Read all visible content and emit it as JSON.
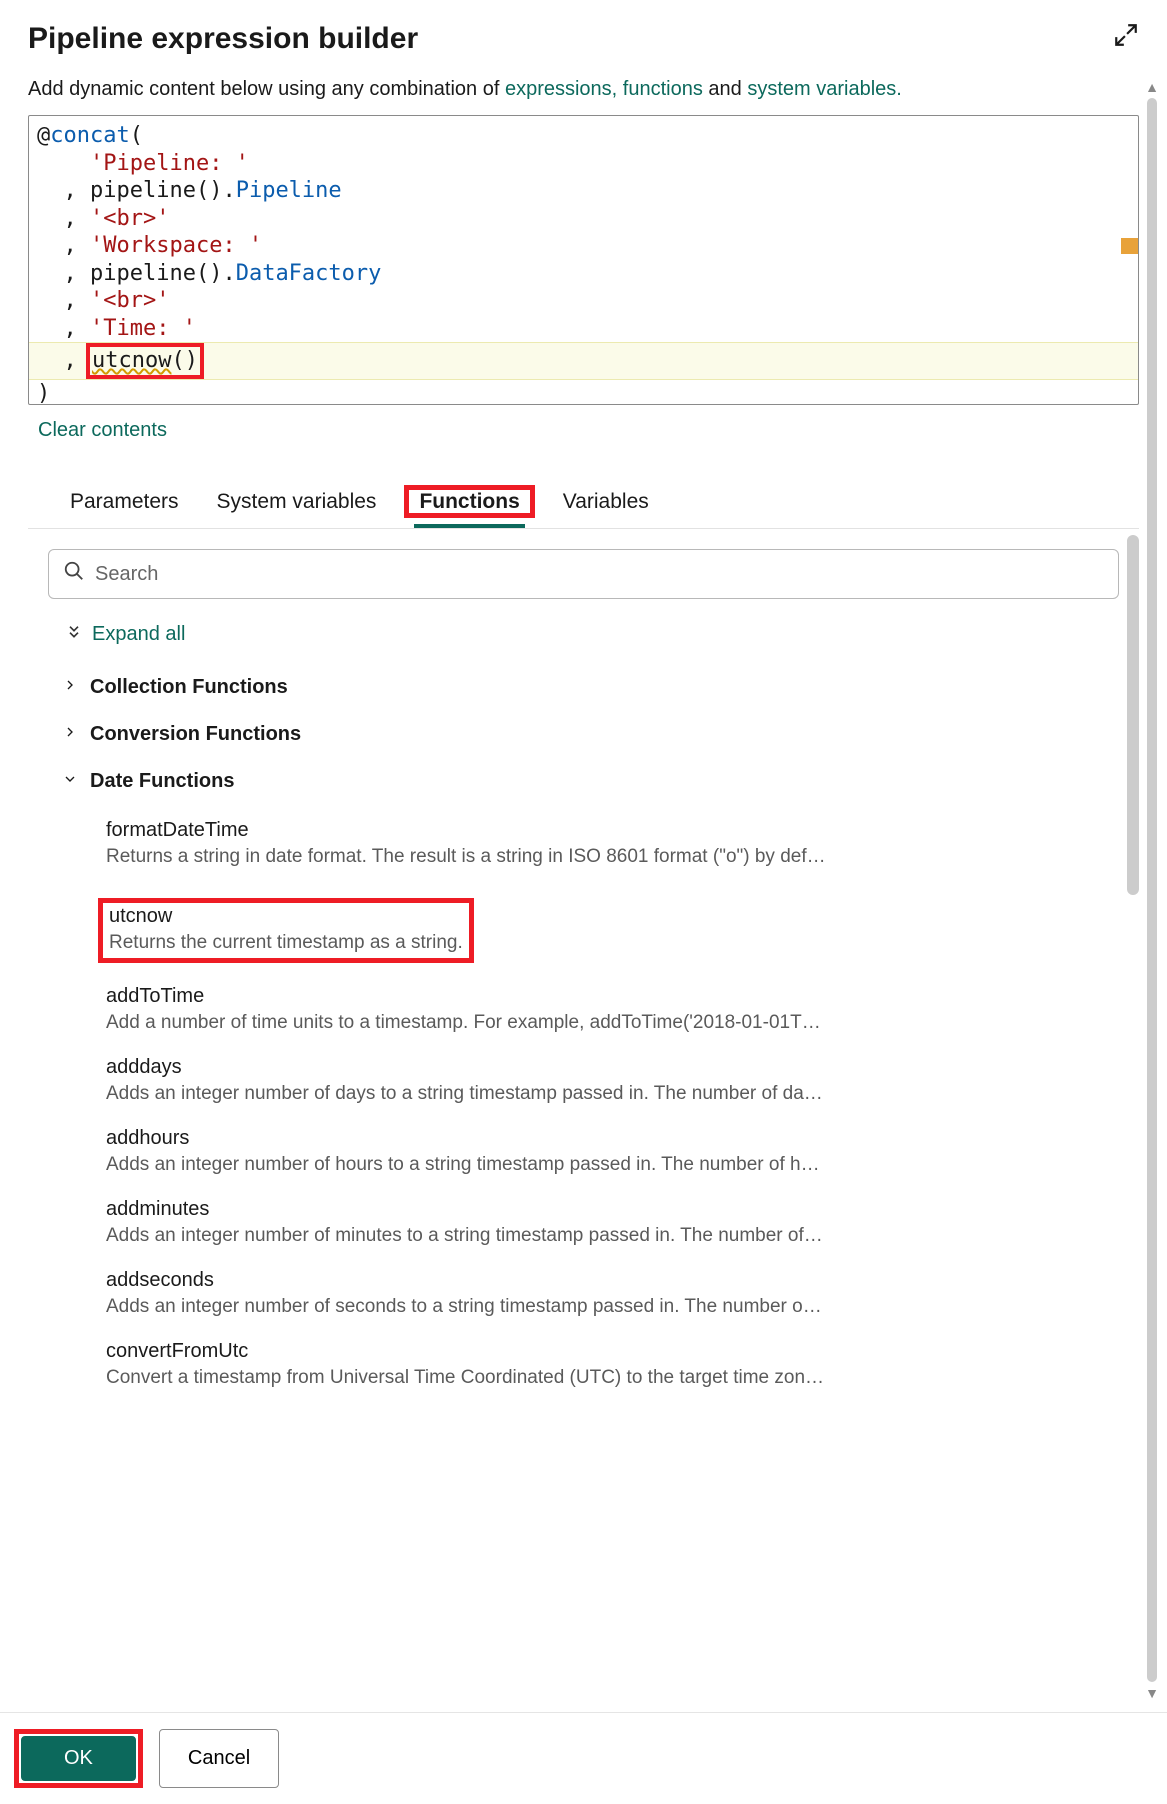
{
  "header": {
    "title": "Pipeline expression builder",
    "intro_prefix": "Add dynamic content below using any combination of ",
    "link_expressions": "expressions,",
    "link_functions": "functions",
    "intro_and": " and ",
    "link_sysvars": "system variables.",
    "clear_contents": "Clear contents"
  },
  "editor": {
    "lines": [
      {
        "segments": [
          {
            "t": "@",
            "c": "ident"
          },
          {
            "t": "concat",
            "c": "fn"
          },
          {
            "t": "(",
            "c": "ident"
          }
        ]
      },
      {
        "indent": "    ",
        "segments": [
          {
            "t": "'Pipeline: '",
            "c": "str"
          }
        ]
      },
      {
        "indent": "  , ",
        "segments": [
          {
            "t": "pipeline",
            "c": "ident"
          },
          {
            "t": "().",
            "c": "ident"
          },
          {
            "t": "Pipeline",
            "c": "prop"
          }
        ]
      },
      {
        "indent": "  , ",
        "segments": [
          {
            "t": "'<br>'",
            "c": "str"
          }
        ]
      },
      {
        "indent": "  , ",
        "segments": [
          {
            "t": "'Workspace: '",
            "c": "str"
          }
        ]
      },
      {
        "indent": "  , ",
        "segments": [
          {
            "t": "pipeline",
            "c": "ident"
          },
          {
            "t": "().",
            "c": "ident"
          },
          {
            "t": "DataFactory",
            "c": "prop"
          }
        ]
      },
      {
        "indent": "  , ",
        "segments": [
          {
            "t": "'<br>'",
            "c": "str"
          }
        ]
      },
      {
        "indent": "  , ",
        "segments": [
          {
            "t": "'Time: '",
            "c": "str"
          }
        ]
      },
      {
        "indent": "  , ",
        "cursor": true,
        "boxed": true,
        "segments": [
          {
            "t": "utcnow",
            "c": "ident",
            "squiggle": true
          },
          {
            "t": "()",
            "c": "ident"
          }
        ]
      },
      {
        "segments": [
          {
            "t": ")",
            "c": "ident"
          }
        ]
      }
    ]
  },
  "tabs": {
    "items": [
      {
        "label": "Parameters",
        "active": false
      },
      {
        "label": "System variables",
        "active": false
      },
      {
        "label": "Functions",
        "active": true,
        "highlight": true
      },
      {
        "label": "Variables",
        "active": false
      }
    ]
  },
  "search": {
    "placeholder": "Search"
  },
  "expand_all_label": "Expand all",
  "categories": [
    {
      "label": "Collection Functions",
      "open": false
    },
    {
      "label": "Conversion Functions",
      "open": false
    },
    {
      "label": "Date Functions",
      "open": true,
      "items": [
        {
          "name": "formatDateTime",
          "desc": "Returns a string in date format. The result is a string in ISO 8601 format (\"o\") by default, unless a format specifier is provided. For exa..."
        },
        {
          "name": "utcnow",
          "desc": "Returns the current timestamp as a string.",
          "highlight": true
        },
        {
          "name": "addToTime",
          "desc": "Add a number of time units to a timestamp. For example, addToTime('2018-01-01T00:00:00Z', 1, 'Day') returns..."
        },
        {
          "name": "adddays",
          "desc": "Adds an integer number of days to a string timestamp passed in. The number of days can be positive or nega..."
        },
        {
          "name": "addhours",
          "desc": "Adds an integer number of hours to a string timestamp passed in. The number of hours can be positive or ne..."
        },
        {
          "name": "addminutes",
          "desc": "Adds an integer number of minutes to a string timestamp passed in. The number of minutes can be positive o..."
        },
        {
          "name": "addseconds",
          "desc": "Adds an integer number of seconds to a string timestamp passed in. The number of seconds can be positive o..."
        },
        {
          "name": "convertFromUtc",
          "desc": "Convert a timestamp from Universal Time Coordinated (UTC) to the target time zone. For example..."
        }
      ]
    }
  ],
  "footer": {
    "ok": "OK",
    "cancel": "Cancel"
  }
}
